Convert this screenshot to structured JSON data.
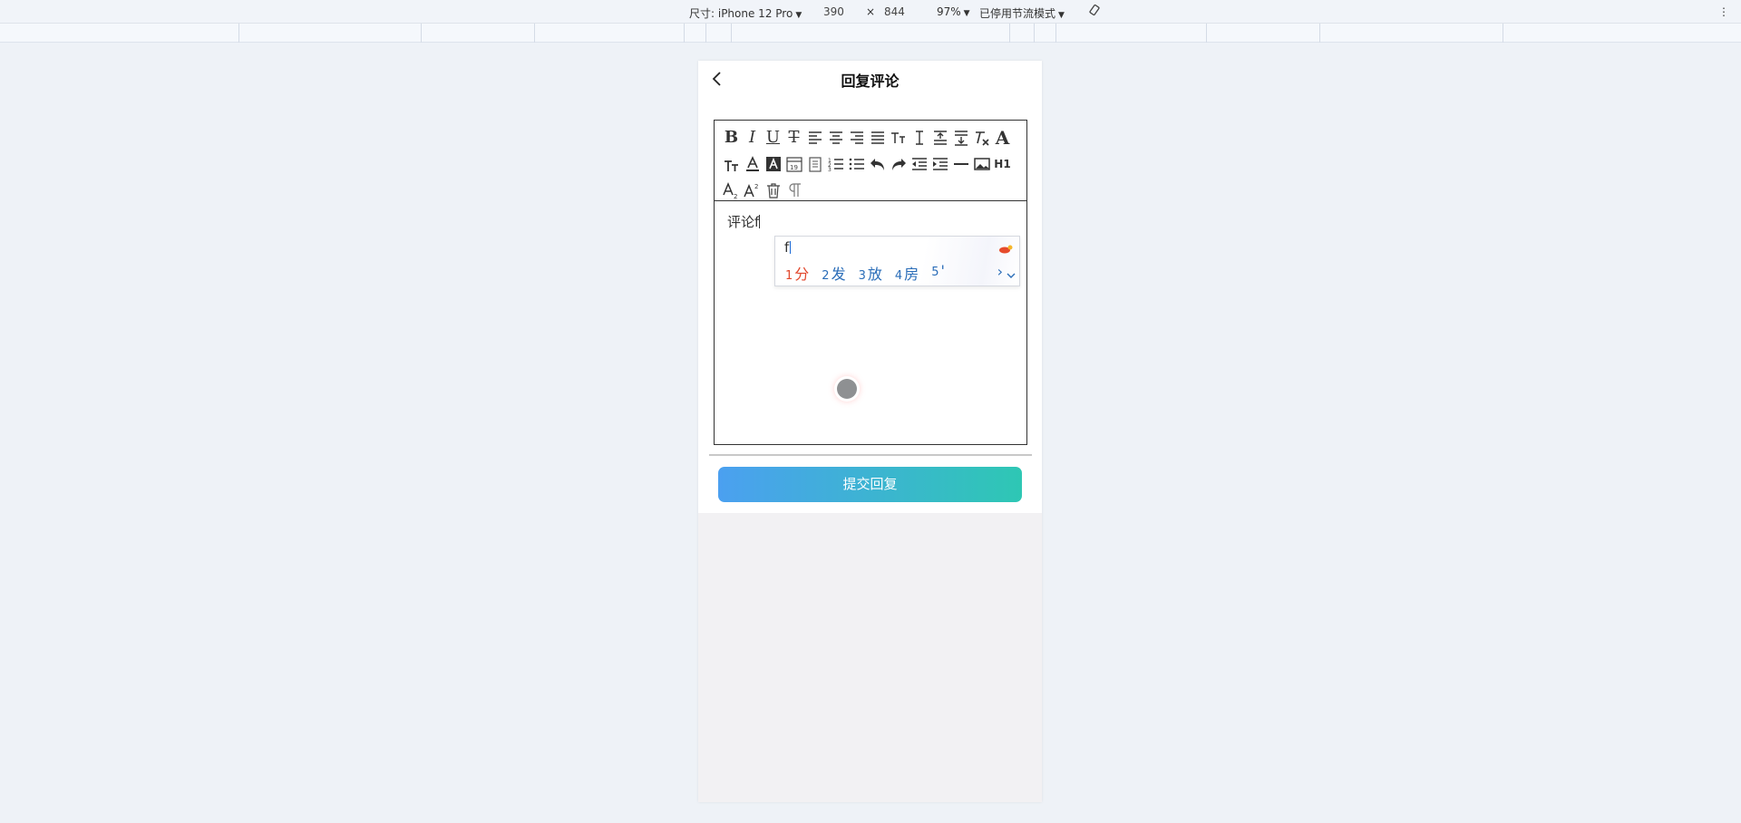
{
  "devtools": {
    "device_label": "尺寸: iPhone 12 Pro",
    "width": "390",
    "times": "×",
    "height": "844",
    "zoom": "97%",
    "throttle": "已停用节流模式",
    "more": "⋮"
  },
  "page": {
    "title": "回复评论",
    "submit_label": "提交回复"
  },
  "editor": {
    "toolbar_row1": [
      "bold-icon",
      "italic-icon",
      "underline-icon",
      "strikethrough-icon",
      "align-left-icon",
      "align-center-icon",
      "align-right-icon",
      "align-justify-icon",
      "font-size-icon",
      "line-height-icon",
      "paragraph-spacing-top-icon",
      "paragraph-spacing-bottom-icon",
      "clear-format-icon",
      "font-family-icon"
    ],
    "toolbar_row2": [
      "text-transform-icon",
      "font-color-icon",
      "background-color-icon",
      "date-icon",
      "template-icon",
      "ordered-list-icon",
      "unordered-list-icon",
      "undo-icon",
      "redo-icon",
      "outdent-icon",
      "indent-icon",
      "horizontal-rule-icon",
      "image-icon",
      "h1-icon"
    ],
    "toolbar_row3": [
      "subscript-icon",
      "superscript-icon",
      "delete-icon",
      "paragraph-mark-icon"
    ],
    "h1_label": "H1",
    "content_text": "评论f"
  },
  "ime": {
    "input": "f",
    "candidates": [
      {
        "num": "1",
        "text": "分"
      },
      {
        "num": "2",
        "text": "发"
      },
      {
        "num": "3",
        "text": "放"
      },
      {
        "num": "4",
        "text": "房"
      },
      {
        "num": "5",
        "text": "'"
      }
    ],
    "next": "›",
    "colors": {
      "selected": "#e2462b",
      "candidate": "#2a6db8"
    }
  },
  "colors": {
    "submit_gradient_start": "#4ba0f0",
    "submit_gradient_end": "#2ec7b4"
  }
}
